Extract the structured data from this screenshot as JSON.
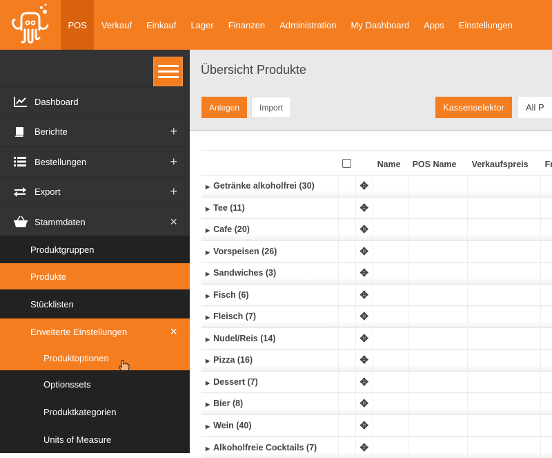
{
  "topnav": {
    "items": [
      "POS",
      "Verkauf",
      "Einkauf",
      "Lager",
      "Finanzen",
      "Administration",
      "My Dashboard",
      "Apps",
      "Einstellungen"
    ],
    "active": "POS"
  },
  "colors": {
    "accent": "#f47d20",
    "sidebar": "#333333"
  },
  "sidebar": {
    "items": [
      {
        "label": "Dashboard",
        "icon": "chart-line-icon",
        "toggle": ""
      },
      {
        "label": "Berichte",
        "icon": "book-icon",
        "toggle": "+"
      },
      {
        "label": "Bestellungen",
        "icon": "list-icon",
        "toggle": "+"
      },
      {
        "label": "Export",
        "icon": "exchange-icon",
        "toggle": "+"
      },
      {
        "label": "Stammdaten",
        "icon": "basket-icon",
        "toggle": "×"
      }
    ],
    "subitems": [
      {
        "label": "Produktgruppen",
        "level": 1,
        "active": false
      },
      {
        "label": "Produkte",
        "level": 1,
        "active": true
      },
      {
        "label": "Stücklisten",
        "level": 1,
        "active": false
      },
      {
        "label": "Erweiterte Einstellungen",
        "level": 1,
        "active": true,
        "toggle": "×"
      },
      {
        "label": "Produktoptionen",
        "level": 2,
        "active": true
      },
      {
        "label": "Optionssets",
        "level": 2,
        "active": false
      },
      {
        "label": "Produktkategorien",
        "level": 2,
        "active": false
      },
      {
        "label": "Units of Measure",
        "level": 2,
        "active": false
      }
    ]
  },
  "main": {
    "title": "Übersicht Produkte",
    "anlegen": "Anlegen",
    "import": "Import",
    "kassenselektor": "Kassenselektor",
    "kasse_value": "All P",
    "columns": [
      "Name",
      "POS Name",
      "Verkaufspreis",
      "Fr"
    ],
    "groups": [
      "Getränke alkoholfrei (30)",
      "Tee (11)",
      "Cafe (20)",
      "Vorspeisen (26)",
      "Sandwiches (3)",
      "Fisch (6)",
      "Fleisch (7)",
      "Nudel/Reis (14)",
      "Pizza (16)",
      "Dessert (7)",
      "Bier (8)",
      "Wein (40)",
      "Alkoholfreie Cocktails (7)"
    ]
  }
}
